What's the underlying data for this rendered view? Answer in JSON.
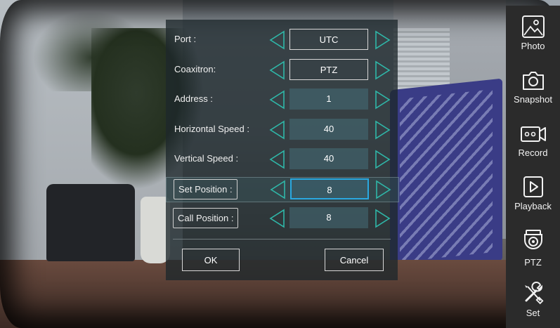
{
  "dialog": {
    "rows": [
      {
        "label": "Port :",
        "value": "UTC"
      },
      {
        "label": "Coaxitron:",
        "value": "PTZ"
      },
      {
        "label": "Address :",
        "value": "1"
      },
      {
        "label": "Horizontal Speed :",
        "value": "40"
      },
      {
        "label": "Vertical Speed :",
        "value": "40"
      },
      {
        "label": "Set Position :",
        "value": "8"
      },
      {
        "label": "Call Position :",
        "value": "8"
      }
    ],
    "ok_label": "OK",
    "cancel_label": "Cancel"
  },
  "toolbar": {
    "items": [
      {
        "label": "Photo",
        "icon": "photo-icon"
      },
      {
        "label": "Snapshot",
        "icon": "camera-icon"
      },
      {
        "label": "Record",
        "icon": "record-icon"
      },
      {
        "label": "Playback",
        "icon": "playback-icon"
      },
      {
        "label": "PTZ",
        "icon": "ptz-camera-icon"
      },
      {
        "label": "Set",
        "icon": "tools-icon"
      }
    ]
  },
  "colors": {
    "arrow": "#2fb7a8",
    "selected_border": "#2aa8e0",
    "toolbar_bg": "#2b2b2b"
  }
}
